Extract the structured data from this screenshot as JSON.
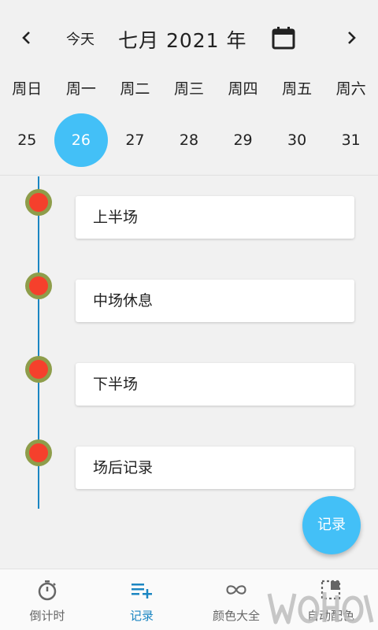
{
  "header": {
    "today_label": "今天",
    "month_title": "七月 2021 年",
    "prev_icon": "chevron-left-icon",
    "next_icon": "chevron-right-icon",
    "calendar_icon": "calendar-icon"
  },
  "week": {
    "days": [
      "周日",
      "周一",
      "周二",
      "周三",
      "周四",
      "周五",
      "周六"
    ],
    "dates": [
      "25",
      "26",
      "27",
      "28",
      "29",
      "30",
      "31"
    ],
    "selected_index": 1
  },
  "timeline": {
    "items": [
      "上半场",
      "中场休息",
      "下半场",
      "场后记录"
    ]
  },
  "fab": {
    "label": "记录"
  },
  "bottom_nav": {
    "tabs": [
      {
        "label": "倒计时",
        "icon": "stopwatch-icon"
      },
      {
        "label": "记录",
        "icon": "playlist-add-icon"
      },
      {
        "label": "颜色大全",
        "icon": "infinity-icon"
      },
      {
        "label": "自动配色",
        "icon": "select-color-icon"
      }
    ],
    "active_index": 1
  },
  "colors": {
    "accent": "#43c0f7",
    "timeline_line": "#1b86c2",
    "dot_outer": "#8e9d4a",
    "dot_inner": "#f5402c",
    "active_tab": "#1b86c2"
  }
}
